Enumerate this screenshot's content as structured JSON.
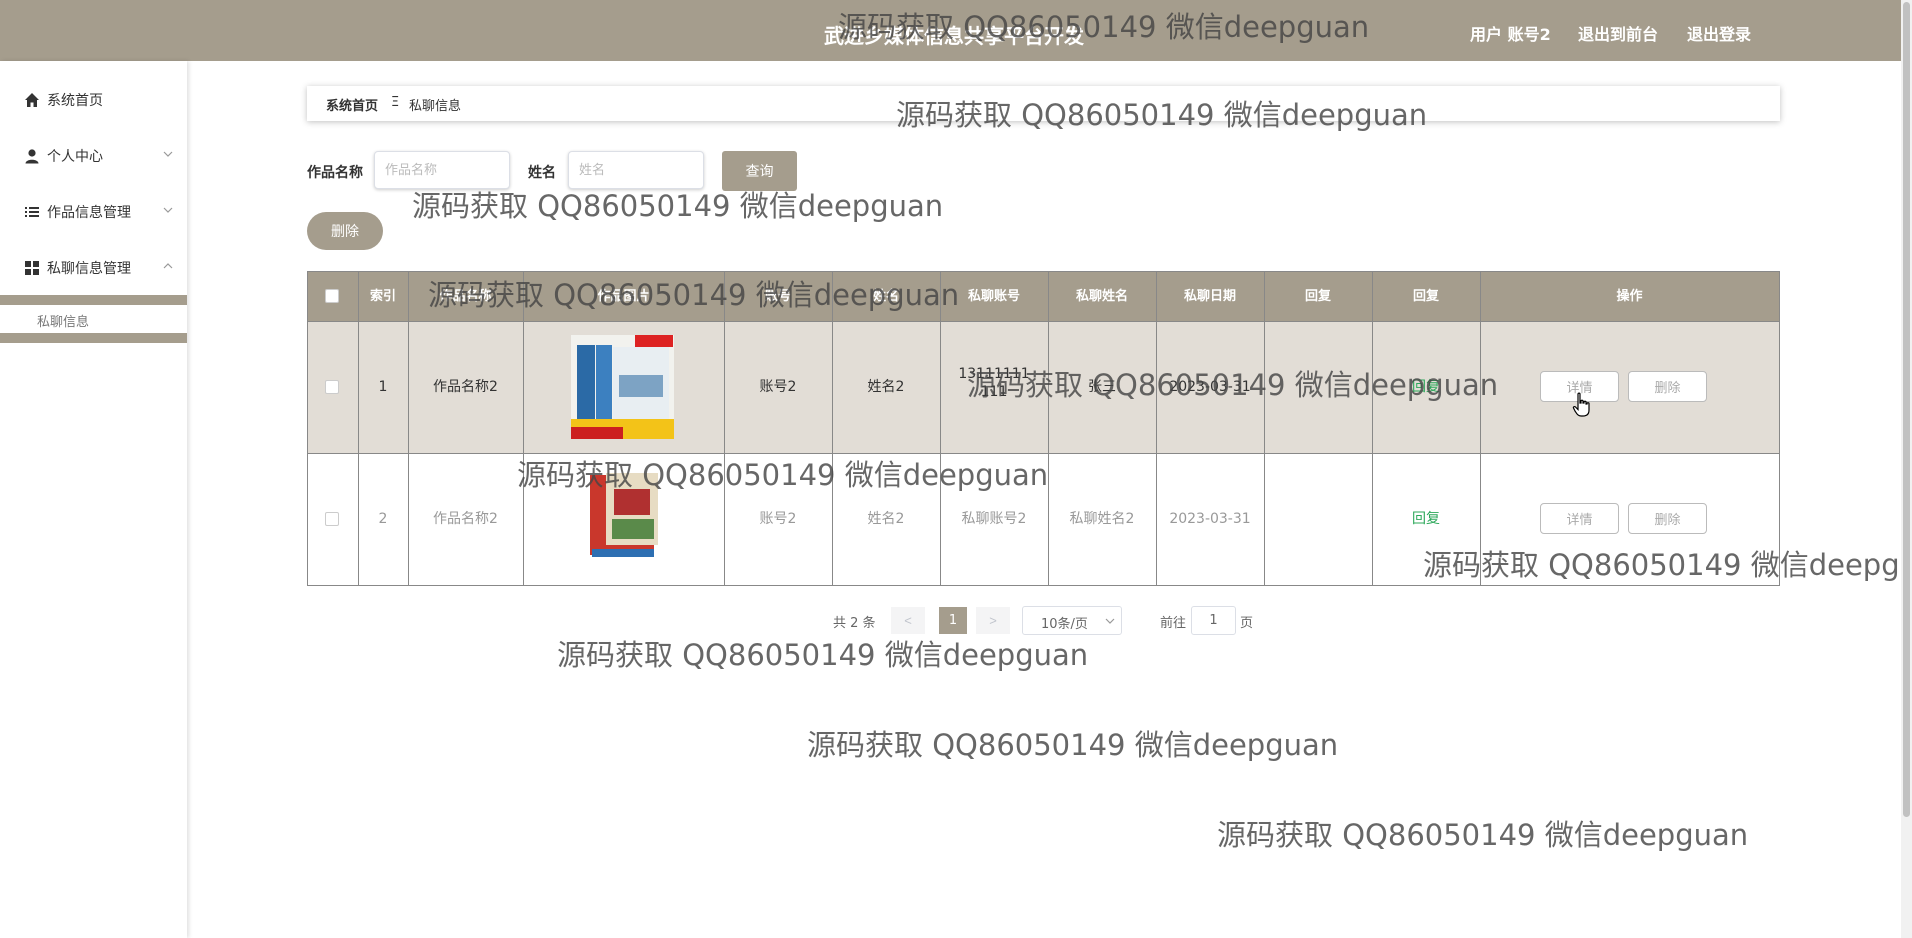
{
  "header": {
    "title": "武进乡媒体信息共享平台开发",
    "links": [
      "用户 账号2",
      "退出到前台",
      "退出登录"
    ]
  },
  "sidebar": {
    "items": [
      {
        "label": "系统首页",
        "icon": "home-icon"
      },
      {
        "label": "个人中心",
        "icon": "user-icon",
        "arrow": "chevron-down-icon"
      },
      {
        "label": "作品信息管理",
        "icon": "list-icon",
        "arrow": "chevron-down-icon"
      },
      {
        "label": "私聊信息管理",
        "icon": "grid-icon",
        "arrow": "chevron-up-icon"
      }
    ],
    "sub_item": "私聊信息"
  },
  "breadcrumb": {
    "home": "系统首页",
    "separator": "Ξ",
    "current": "私聊信息"
  },
  "search": {
    "work_label": "作品名称",
    "work_placeholder": "作品名称",
    "name_label": "姓名",
    "name_placeholder": "姓名",
    "query_button": "查询"
  },
  "delete_button": "删除",
  "table": {
    "headers": [
      "索引",
      "作品名称",
      "作品图片",
      "账号",
      "姓名",
      "私聊账号",
      "私聊姓名",
      "私聊日期",
      "回复",
      "回复",
      "操作"
    ],
    "rows": [
      {
        "index": "1",
        "work": "作品名称2",
        "account": "账号2",
        "name": "姓名2",
        "pm_account": "13111111111",
        "pm_name": "张三",
        "date": "2023-03-31",
        "reply_text": "",
        "reply_action": "回复",
        "detail": "详情",
        "delete": "删除"
      },
      {
        "index": "2",
        "work": "作品名称2",
        "account": "账号2",
        "name": "姓名2",
        "pm_account": "私聊账号2",
        "pm_name": "私聊姓名2",
        "date": "2023-03-31",
        "reply_text": "",
        "reply_action": "回复",
        "detail": "详情",
        "delete": "删除"
      }
    ]
  },
  "pagination": {
    "total": "共 2 条",
    "prev": "<",
    "current": "1",
    "next": ">",
    "page_size": "10条/页",
    "goto": "前往",
    "goto_value": "1",
    "page_unit": "页"
  },
  "watermark": "源码获取 QQ86050149 微信deepguan",
  "colors": {
    "theme": "#a59d8d",
    "row_highlight": "#e2ddd6",
    "reply_link": "#2ca85a"
  }
}
